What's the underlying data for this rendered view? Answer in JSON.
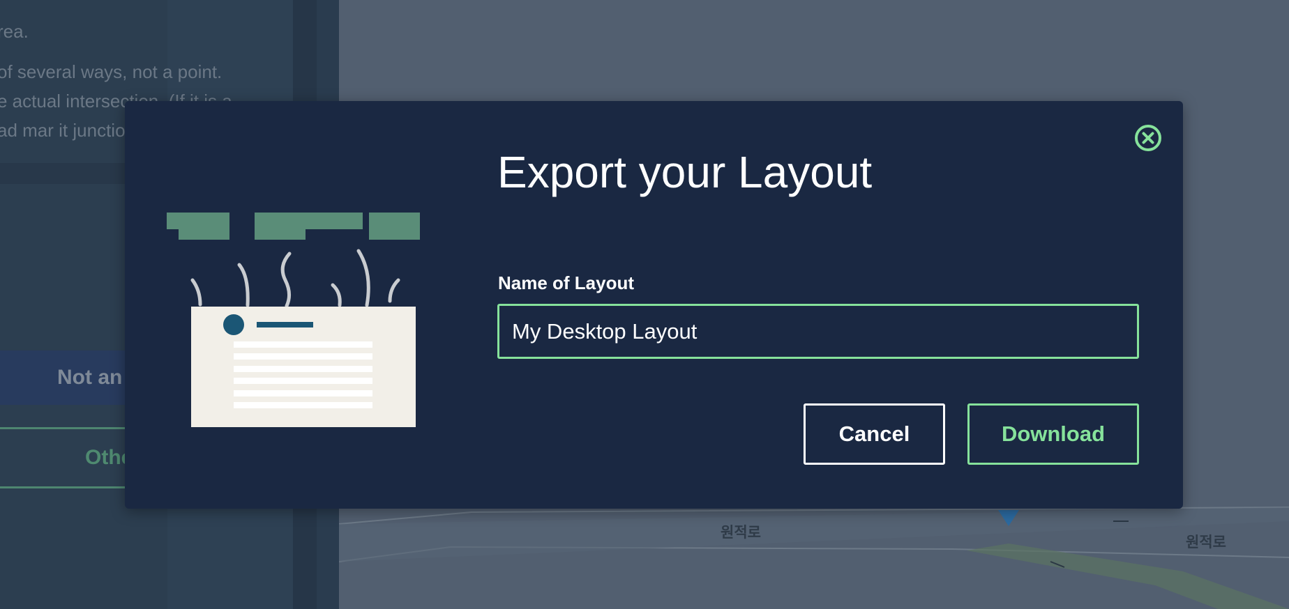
{
  "background": {
    "sidebar": {
      "paragraph_lines": [
        "rea.",
        "of several ways, not a point.",
        "e actual intersection. (If it is a",
        "ad mar it junctio"
      ],
      "choice_primary_label": "Not an",
      "choice_other_label": "Othe"
    },
    "map": {
      "road_label_1": "원적로",
      "road_label_2": "원적로"
    }
  },
  "modal": {
    "title": "Export your Layout",
    "close_icon": "close-circle-icon",
    "name_field": {
      "label": "Name of Layout",
      "value": "My Desktop Layout"
    },
    "buttons": {
      "cancel": "Cancel",
      "download": "Download"
    },
    "illustration_icon": "exported-document-illustration"
  },
  "colors": {
    "modal_bg": "#1a2842",
    "accent_green": "#86e29b",
    "illustration_card": "#f2efe8",
    "illustration_leaf": "#5a8d78",
    "illustration_dot": "#1b5675"
  }
}
